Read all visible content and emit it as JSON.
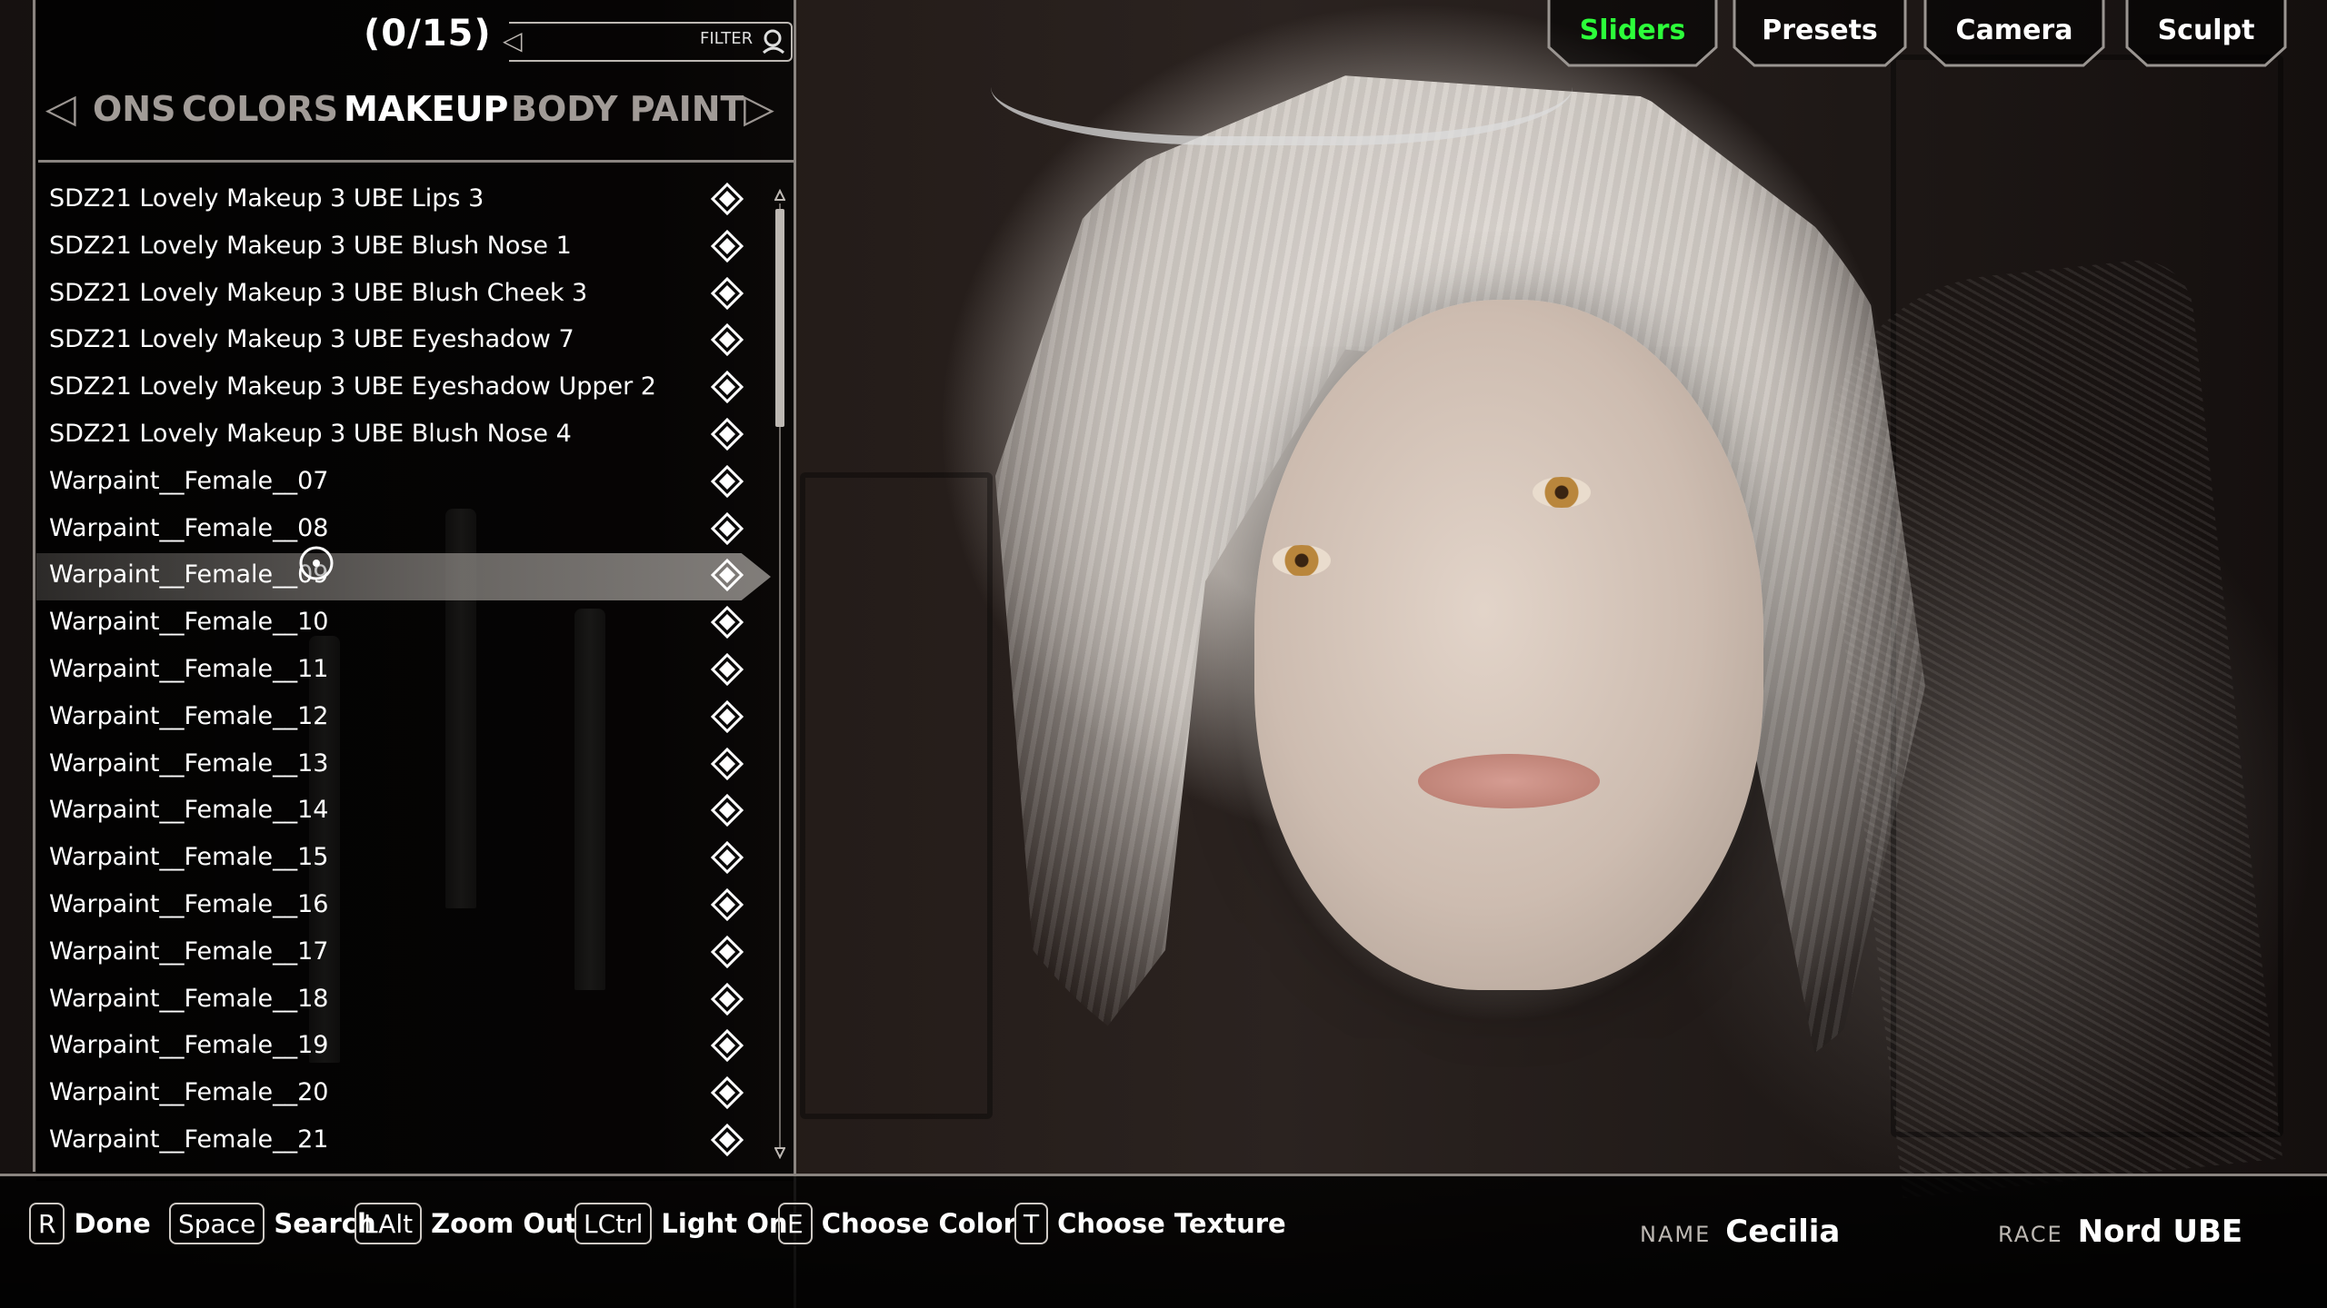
{
  "header": {
    "counter": "(0/15)",
    "filter_label": "FILTER"
  },
  "tabs": {
    "items": [
      {
        "label": "ONS",
        "active": false
      },
      {
        "label": "COLORS",
        "active": false
      },
      {
        "label": "MAKEUP",
        "active": true
      },
      {
        "label": "BODY PAINT",
        "active": false
      }
    ]
  },
  "list": {
    "selected_index": 8,
    "items": [
      "SDZ21 Lovely Makeup 3 UBE Lips 3",
      "SDZ21 Lovely Makeup 3 UBE Blush Nose 1",
      "SDZ21 Lovely Makeup 3 UBE Blush Cheek 3",
      "SDZ21 Lovely Makeup 3 UBE Eyeshadow 7",
      "SDZ21 Lovely Makeup 3 UBE Eyeshadow Upper 2",
      "SDZ21 Lovely Makeup 3 UBE Blush Nose 4",
      "Warpaint__Female__07",
      "Warpaint__Female__08",
      "Warpaint__Female__09",
      "Warpaint__Female__10",
      "Warpaint__Female__11",
      "Warpaint__Female__12",
      "Warpaint__Female__13",
      "Warpaint__Female__14",
      "Warpaint__Female__15",
      "Warpaint__Female__16",
      "Warpaint__Female__17",
      "Warpaint__Female__18",
      "Warpaint__Female__19",
      "Warpaint__Female__20",
      "Warpaint__Female__21"
    ]
  },
  "modes": {
    "items": [
      {
        "label": "Sliders",
        "active": true
      },
      {
        "label": "Presets",
        "active": false
      },
      {
        "label": "Camera",
        "active": false
      },
      {
        "label": "Sculpt",
        "active": false
      }
    ],
    "active_color": "#2cff3a"
  },
  "controls": [
    {
      "key": "R",
      "label": "Done"
    },
    {
      "key": "Space",
      "label": "Search"
    },
    {
      "key": "LAlt",
      "label": "Zoom Out"
    },
    {
      "key": "LCtrl",
      "label": "Light On"
    },
    {
      "key": "E",
      "label": "Choose Color"
    },
    {
      "key": "T",
      "label": "Choose Texture"
    }
  ],
  "character": {
    "name_label": "NAME",
    "name": "Cecilia",
    "race_label": "RACE",
    "race": "Nord UBE"
  }
}
